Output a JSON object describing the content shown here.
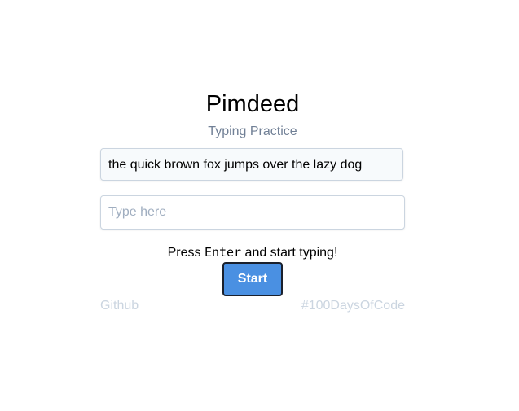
{
  "app": {
    "title": "Pimdeed",
    "subtitle": "Typing Practice"
  },
  "sample": {
    "text": "the quick brown fox jumps over the lazy dog"
  },
  "input": {
    "value": "",
    "placeholder": "Type here"
  },
  "hint": {
    "prefix": "Press ",
    "key": "Enter",
    "suffix": " and start typing!"
  },
  "start_button": {
    "label": "Start"
  },
  "footer": {
    "left_link": "Github",
    "right_link": "#100DaysOfCode"
  },
  "colors": {
    "accent": "#4a90e2",
    "muted_text": "#718096",
    "footer_text": "#cbd5e0"
  }
}
